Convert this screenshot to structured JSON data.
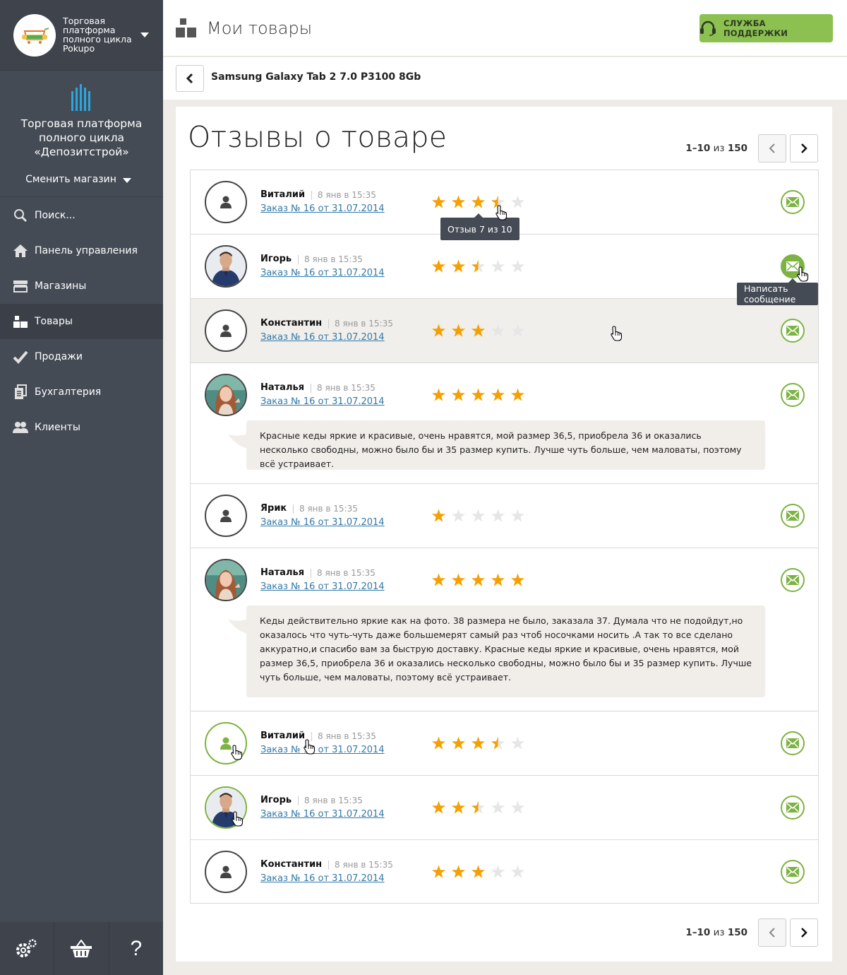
{
  "sidebar": {
    "platform": "Торговая платформа полного цикла Pokupo",
    "store_name": "Торговая платформа полного цикла «Депозитстрой»",
    "switch_store": "Сменить магазин",
    "nav": [
      {
        "label": "Поиск...",
        "icon": "search-icon"
      },
      {
        "label": "Панель управления",
        "icon": "home-icon"
      },
      {
        "label": "Магазины",
        "icon": "store-icon"
      },
      {
        "label": "Товары",
        "icon": "boxes-icon",
        "active": true
      },
      {
        "label": "Продажи",
        "icon": "check-icon"
      },
      {
        "label": "Бухгалтерия",
        "icon": "documents-icon"
      },
      {
        "label": "Клиенты",
        "icon": "users-icon"
      }
    ],
    "bottom": {
      "settings": "gear-icon",
      "cart": "basket-icon",
      "help": "?"
    }
  },
  "header": {
    "title": "Мои товары",
    "support": "СЛУЖБА ПОДДЕРЖКИ"
  },
  "product": {
    "name": "Samsung Galaxy Tab 2 7.0 P3100 8Gb"
  },
  "reviews_section": {
    "title": "Отзывы о товаре",
    "pager": {
      "range": "1–10",
      "of": "из",
      "total": "150"
    },
    "tooltip_rating": "Отзыв 7 из 10",
    "tooltip_message": "Написать сообщение",
    "reviews": [
      {
        "name": "Виталий",
        "date": "8 янв в 15:35",
        "order": "Заказ № 16 от 31.07.2014",
        "rating": 3.5
      },
      {
        "name": "Игорь",
        "date": "8 янв в 15:35",
        "order": "Заказ № 16 от 31.07.2014",
        "rating": 2.5
      },
      {
        "name": "Константин",
        "date": "8 янв в 15:35",
        "order": "Заказ № 16 от 31.07.2014",
        "rating": 3
      },
      {
        "name": "Наталья",
        "date": "8 янв в 15:35",
        "order": "Заказ № 16 от 31.07.2014",
        "rating": 5,
        "text": "Красные кеды яркие и красивые, очень нравятся, мой размер 36,5, приобрела 36 и оказались несколько свободны, можно было бы и 35 размер купить. Лучше чуть больше, чем маловаты, поэтому всё устраивает."
      },
      {
        "name": "Ярик",
        "date": "8 янв в 15:35",
        "order": "Заказ № 16 от 31.07.2014",
        "rating": 1
      },
      {
        "name": "Наталья",
        "date": "8 янв в 15:35",
        "order": "Заказ № 16 от 31.07.2014",
        "rating": 5,
        "text": "Кеды действительно яркие как на фото. 38 размера не было, заказала 37. Думала что не подойдут,но оказалось что чуть-чуть даже большемерят самый раз чтоб носочками носить .А так то все сделано аккуратно,и спасибо вам за быструю доставку. Красные кеды яркие и красивые, очень нравятся, мой размер 36,5, приобрела 36 и оказались несколько свободны, можно было бы и 35 размер купить. Лучше чуть больше, чем маловаты, поэтому всё устраивает."
      },
      {
        "name": "Виталий",
        "date": "8 янв в 15:35",
        "order": "Заказ № 16 от 31.07.2014",
        "rating": 3.5
      },
      {
        "name": "Игорь",
        "date": "8 янв в 15:35",
        "order": "Заказ № 16 от 31.07.2014",
        "rating": 2.5
      },
      {
        "name": "Константин",
        "date": "8 янв в 15:35",
        "order": "Заказ № 16 от 31.07.2014",
        "rating": 3
      }
    ]
  },
  "colors": {
    "accent": "#8cc152",
    "star": "#f5a000",
    "star_empty": "#e6e6e6",
    "sidebar": "#454b55",
    "link": "#3479a8"
  }
}
